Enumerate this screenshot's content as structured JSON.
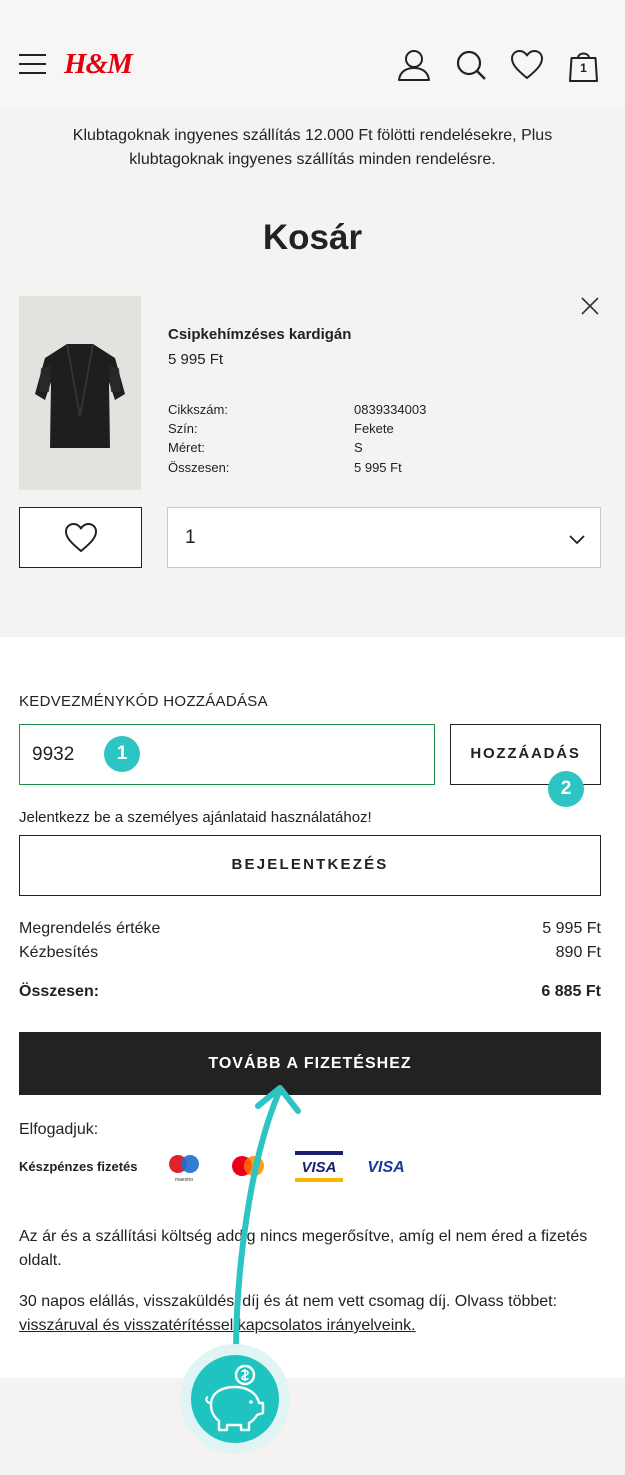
{
  "header": {
    "logo_text": "H&M",
    "brand_color": "#e50010",
    "icons": [
      "menu-icon",
      "account-icon",
      "search-icon",
      "heart-icon",
      "bag-icon"
    ],
    "bag_count": "1"
  },
  "promo_text": "Klubtagoknak ingyenes szállítás 12.000 Ft fölötti rendelésekre, Plus klubtagoknak ingyenes szállítás minden rendelésre.",
  "page_title": "Kosár",
  "cart_item": {
    "name": "Csipkehímzéses kardigán",
    "price": "5 995 Ft",
    "specs": [
      {
        "label": "Cikkszám:",
        "value": "0839334003"
      },
      {
        "label": "Szín:",
        "value": "Fekete"
      },
      {
        "label": "Méret:",
        "value": "S"
      },
      {
        "label": "Összesen:",
        "value": "5 995 Ft"
      }
    ],
    "quantity": "1"
  },
  "discount": {
    "label": "KEDVEZMÉNYKÓD HOZZÁADÁSA",
    "value": "9932",
    "badge_1": "1",
    "add_label": "HOZZÁADÁS",
    "badge_2": "2",
    "badge_color": "#2cc5c3"
  },
  "login": {
    "prompt": "Jelentkezz be a személyes ajánlataid használatához!",
    "button_label": "BEJELENTKEZÉS"
  },
  "summary": {
    "order_value_label": "Megrendelés értéke",
    "order_value": "5 995 Ft",
    "delivery_label": "Kézbesítés",
    "delivery_value": "890 Ft",
    "total_label": "Összesen:",
    "total_value": "6 885 Ft"
  },
  "checkout_label": "TOVÁBB A FIZETÉSHEZ",
  "payments": {
    "accept_label": "Elfogadjuk:",
    "cash_label": "Készpénzes fizetés",
    "icons": [
      "maestro-icon",
      "mastercard-icon",
      "visa-electron-icon",
      "visa-icon"
    ]
  },
  "notes": {
    "price_note": "Az ár és a szállítási költség addig nincs megerősítve, amíg el nem éred a fizetés oldalt.",
    "return_note": "30 napos elállás, visszaküldési díj és át nem vett csomag díj. Olvass többet:",
    "return_link": "visszáruval és visszatérítéssel kapcsolatos irányelveink."
  }
}
